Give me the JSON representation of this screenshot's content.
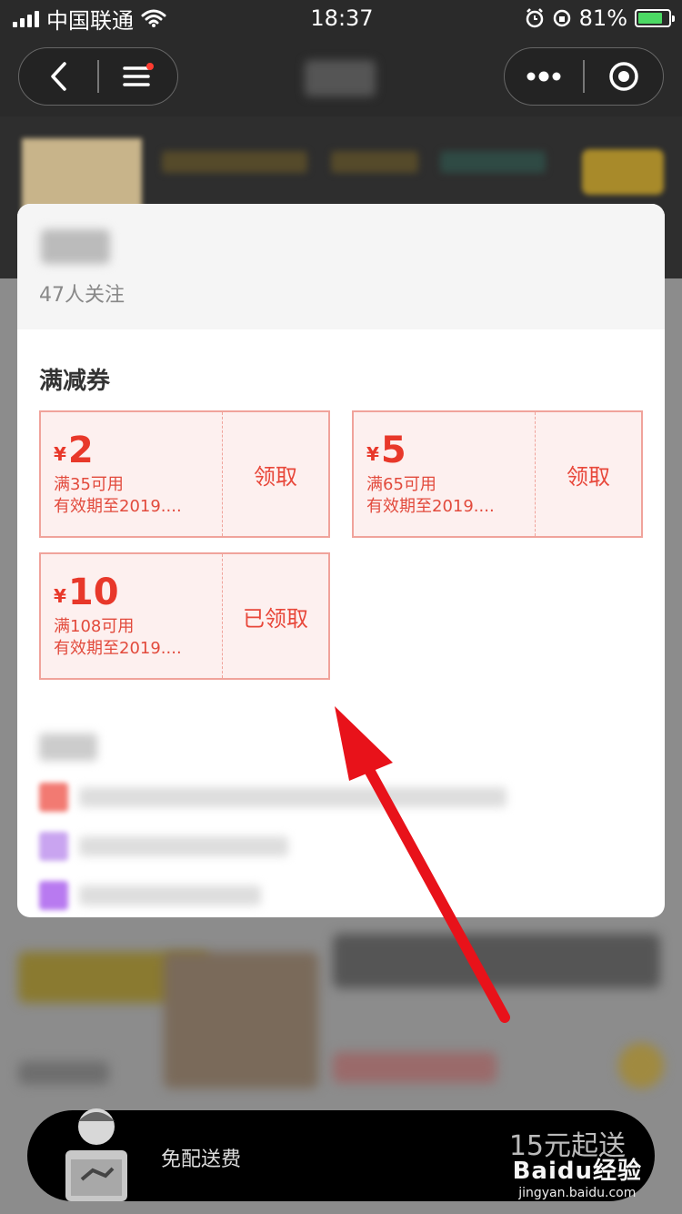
{
  "status_bar": {
    "carrier": "中国联通",
    "time": "18:37",
    "battery_percent": "81%",
    "battery_level": 0.81
  },
  "modal": {
    "followers": "47人关注",
    "section_title": "满减券",
    "coupons": [
      {
        "currency": "¥",
        "amount": "2",
        "condition": "满35可用",
        "validity": "有效期至2019....",
        "action": "领取"
      },
      {
        "currency": "¥",
        "amount": "5",
        "condition": "满65可用",
        "validity": "有效期至2019....",
        "action": "领取"
      },
      {
        "currency": "¥",
        "amount": "10",
        "condition": "满108可用",
        "validity": "有效期至2019....",
        "action": "已领取"
      }
    ]
  },
  "bottom_bar": {
    "delivery_text": "免配送费",
    "min_order_text": "15元起送"
  },
  "watermark": {
    "logo": "Baidu经验",
    "url": "jingyan.baidu.com"
  },
  "colors": {
    "coupon_red": "#e8382a",
    "coupon_bg": "#fdf0ef",
    "coupon_border": "#f0a39b",
    "arrow_red": "#e8121a"
  }
}
